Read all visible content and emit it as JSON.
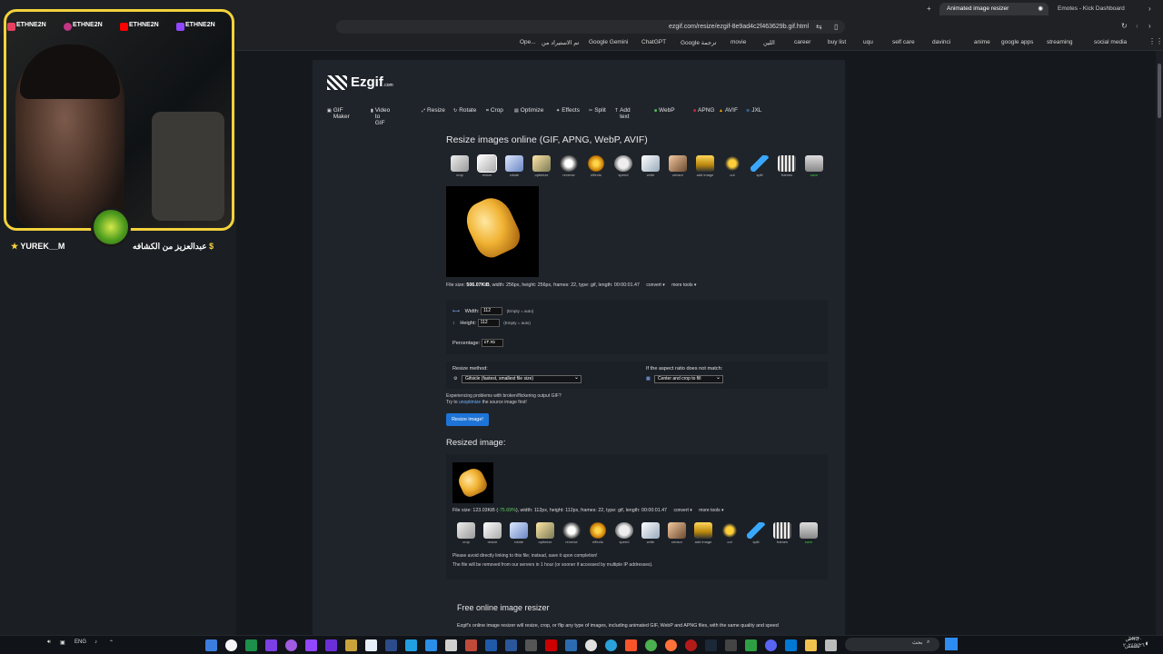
{
  "browser": {
    "tabs": [
      {
        "label": "Animated image resizer",
        "active": true
      },
      {
        "label": "Emotes - Kick Dashboard",
        "active": false
      }
    ],
    "address": "ezgif.com/resize/ezgif-8e9ad4c2f463629b.gif.html",
    "bookmarks": [
      "Ope...",
      "تم الاستيراد من",
      "Google Gemini",
      "ChatGPT",
      "Google ترجمة",
      "movie",
      "اللين",
      "career",
      "buy list",
      "uqu",
      "self care",
      "davinci",
      "anime",
      "google apps",
      "streaming",
      "social media"
    ]
  },
  "overlay": {
    "handles": [
      "ETHNE2N",
      "ETHNE2N",
      "ETHNE2N",
      "ETHNE2N"
    ],
    "sub_left": "YUREK__M",
    "sub_right": "عبدالعزيز من الكشافه"
  },
  "site": {
    "logo": "Ezgif",
    "logo_suffix": ".com",
    "nav": [
      "GIF Maker",
      "Video to GIF",
      "Resize",
      "Rotate",
      "Crop",
      "Optimize",
      "Effects",
      "Split",
      "Add text",
      "WebP",
      "APNG",
      "AVIF",
      "JXL"
    ],
    "title": "Resize images online (GIF, APNG, WebP, AVIF)",
    "tools": [
      "crop",
      "resize",
      "rotate",
      "optimize",
      "reverse",
      "effects",
      "speed",
      "write",
      "censor",
      "add image",
      "cut",
      "split",
      "frames",
      "save"
    ],
    "file_info": {
      "label": "File size:",
      "size": "506.07KiB",
      "rest": ", width: 256px, height: 256px, frames: 22, type: gif, length: 00:00:01.47",
      "convert": "convert ▾",
      "more": "more tools ▾"
    },
    "form": {
      "width_label": "Width:",
      "width_value": "112",
      "height_label": "Height:",
      "height_value": "112",
      "auto_hint": "(Empty = auto)",
      "percentage_label": "Percentage:",
      "percentage_value": "٤٣.٧٥",
      "method_label": "Resize method:",
      "method_value": "Gifsicle (fastest, smallest file size)",
      "aspect_label": "If the aspect ratio does not match:",
      "aspect_value": "Center and crop to fill",
      "problem_text": "Experiencing problems with broken/flickering output GIF?",
      "try_prefix": "Try to",
      "unoptimize_link": "unoptimize",
      "try_suffix": "the source image first!",
      "submit": "Resize image!"
    },
    "resized": {
      "heading": "Resized image:",
      "label": "File size:",
      "size": "123.03KiB",
      "percent": "-75.69%",
      "rest": ", width: 112px, height: 112px, frames: 22, type: gif, length: 00:00:01.47",
      "convert": "convert ▾",
      "more": "more tools ▾",
      "notice1": "Please avoid directly linking to this file; instead, save it upon completion!",
      "notice2": "The file will be removed from our servers in 1 hour (or sooner if accessed by multiple IP addresses)."
    },
    "footer": {
      "heading": "Free online image resizer",
      "text": "Ezgif's online image resizer will resize, crop, or flip any type of images, including animated GIF, WebP and APNG files, with the same quality and speed"
    }
  },
  "taskbar": {
    "date": "٢٠٢٤/٧/٢٦",
    "time": "٧:٣٠ ص",
    "lang": "ENG",
    "search": "بحث",
    "weather": "24°C",
    "weather_desc": "مشمس"
  }
}
